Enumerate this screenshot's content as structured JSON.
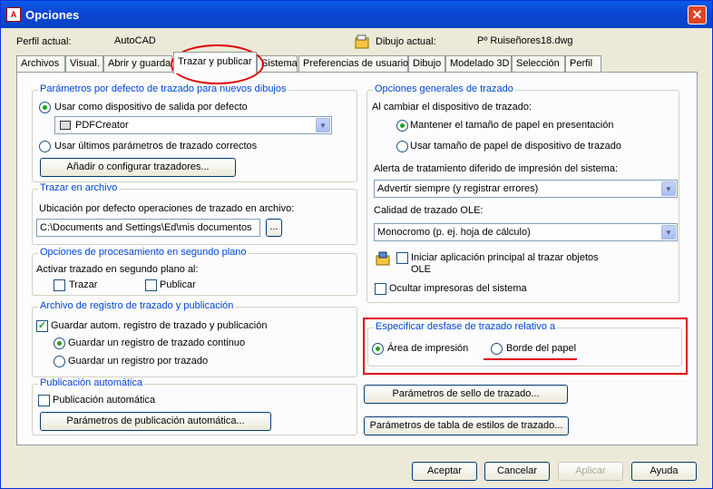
{
  "window": {
    "title": "Opciones",
    "app_icon_text": "A"
  },
  "header": {
    "perfil_label": "Perfil actual:",
    "perfil_value": "AutoCAD",
    "dibujo_label": "Dibujo actual:",
    "dibujo_value": "Pº Ruiseñores18.dwg"
  },
  "tabs": [
    "Archivos",
    "Visual.",
    "Abrir y guardar",
    "Trazar y publicar",
    "Sistema",
    "Preferencias de usuario",
    "Dibujo",
    "Modelado 3D",
    "Selección",
    "Perfil"
  ],
  "active_tab": "Trazar y publicar",
  "plot_defaults": {
    "legend": "Parámetros por defecto de trazado para nuevos dibujos",
    "use_default_device": "Usar como dispositivo de salida por defecto",
    "device_value": "PDFCreator",
    "use_last": "Usar últimos parámetros de trazado correctos",
    "add_configure": "Añadir o configurar trazadores..."
  },
  "plot_to_file": {
    "legend": "Trazar en archivo",
    "location_label": "Ubicación por defecto operaciones de trazado en archivo:",
    "location_value": "C:\\Documents and Settings\\Ed\\mis documentos",
    "browse": "..."
  },
  "background": {
    "legend": "Opciones de procesamiento en segundo plano",
    "enable_label": "Activar trazado en segundo plano al:",
    "plot": "Trazar",
    "publish": "Publicar"
  },
  "log": {
    "legend": "Archivo de registro de trazado y publicación",
    "auto_save": "Guardar autom. registro de trazado y publicación",
    "continuous": "Guardar un registro de trazado continuo",
    "per_plot": "Guardar un registro por trazado"
  },
  "auto_publish": {
    "legend": "Publicación automática",
    "checkbox": "Publicación automática",
    "settings": "Parámetros de publicación automática..."
  },
  "general": {
    "legend": "Opciones generales de trazado",
    "change_device_label": "Al cambiar el dispositivo de trazado:",
    "keep_size": "Mantener el tamaño de papel en presentación",
    "use_device_size": "Usar tamaño de papel de dispositivo de trazado",
    "spool_label": "Alerta de tratamiento diferido de impresión del sistema:",
    "spool_value": "Advertir siempre (y registrar errores)",
    "ole_label": "Calidad de trazado OLE:",
    "ole_value": "Monocromo (p. ej. hoja de cálculo)",
    "ole_launch_line1": "Iniciar aplicación principal al trazar objetos",
    "ole_launch_line2": "OLE",
    "hide_printers": "Ocultar impresoras del sistema"
  },
  "offset": {
    "legend": "Especificar desfase de trazado relativo a",
    "printable_area": "Área de impresión",
    "paper_edge": "Borde del papel"
  },
  "stamp_button": "Parámetros de sello de trazado...",
  "style_table_button": "Parámetros de tabla de estilos de trazado...",
  "footer": {
    "ok": "Aceptar",
    "cancel": "Cancelar",
    "apply": "Aplicar",
    "help": "Ayuda"
  },
  "colors": {
    "title_bar": "#0a5ce8",
    "group_legend": "#0046d5",
    "annotation": "#e00000"
  }
}
